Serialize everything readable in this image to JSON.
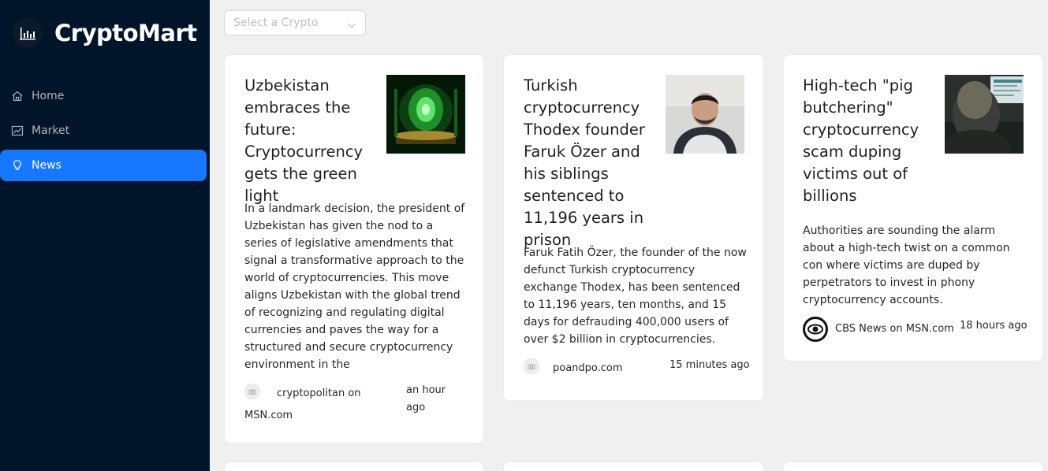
{
  "app": {
    "title": "CryptoMart"
  },
  "sidebar": {
    "items": [
      {
        "label": "Home",
        "icon": "home-icon"
      },
      {
        "label": "Market",
        "icon": "chart-line-icon"
      },
      {
        "label": "News",
        "icon": "bulb-icon",
        "active": true
      }
    ]
  },
  "search": {
    "placeholder": "Select a Crypto"
  },
  "news": [
    {
      "title": "Uzbekistan embraces the future: Cryptocurrency gets the green light",
      "description": "In a landmark decision, the president of Uzbekistan has given the nod to a series of legislative amendments that signal a transformative approach to the world of cryptocurrencies. This move aligns Uzbekistan with the global trend of recognizing and regulating digital currencies and paves the way for a structured and secure cryptocurrency environment in the",
      "provider": "cryptopolitan on MSN.com",
      "time": "an hour ago",
      "thumb": "green-crystal-image"
    },
    {
      "title": "Turkish cryptocurrency Thodex founder Faruk Özer and his siblings sentenced to 11,196 years in prison",
      "description": "Faruk Fatih Özer, the founder of the now defunct Turkish cryptocurrency exchange Thodex, has been sentenced to 11,196 years, ten months, and 15 days for defrauding 400,000 users of over $2 billion in cryptocurrencies.",
      "provider": "poandpo.com",
      "time": "15 minutes ago",
      "thumb": "man-portrait-image"
    },
    {
      "title": "High-tech \"pig butchering\" cryptocurrency scam duping victims out of billions",
      "description": "Authorities are sounding the alarm about a high-tech twist on a common con where victims are duped by perpetrators to invest in phony cryptocurrency accounts.",
      "provider": "CBS News on MSN.com",
      "time": "18 hours ago",
      "thumb": "person-at-screens-image"
    }
  ],
  "colors": {
    "sidebar_bg": "#001529",
    "accent": "#1677ff",
    "page_bg": "#f0f0f0"
  }
}
